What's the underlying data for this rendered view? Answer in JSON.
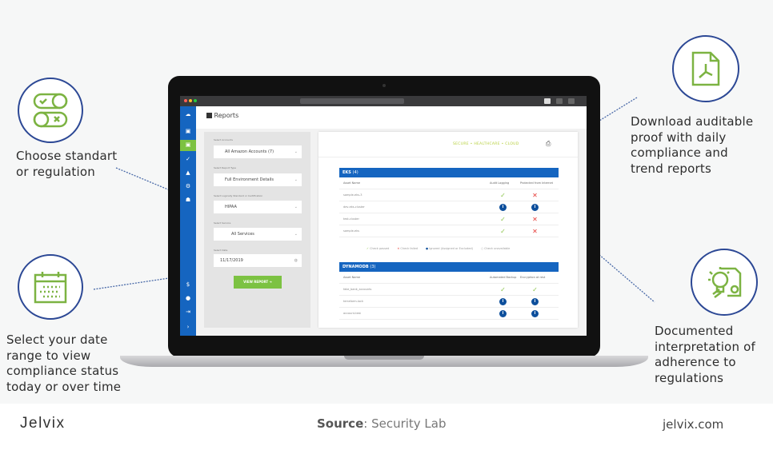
{
  "callouts": {
    "standard": [
      "Choose standart",
      "or regulation"
    ],
    "date": [
      "Select your date",
      "range to view",
      "compliance status",
      "today or over time"
    ],
    "download": [
      "Download auditable",
      "proof with daily",
      "compliance and",
      "trend reports"
    ],
    "documented": [
      "Documented",
      "interpretation of",
      "adherence to",
      "regulations"
    ]
  },
  "icons": {
    "standard": "toggle-switches-icon",
    "date": "calendar-icon",
    "download": "pdf-file-icon",
    "documented": "lightbulb-document-icon"
  },
  "colors": {
    "circle": "#2c4895",
    "icon": "#7cb342",
    "sidebar": "#1565c0",
    "button": "#7cc242",
    "tagline": "#b5cf3a"
  },
  "app": {
    "page_title": "Reports",
    "form": {
      "accounts_label": "Select Accounts",
      "accounts_value": "All Amazon Accounts (7)",
      "report_type_label": "Select Report Type",
      "report_type_value": "Full Environment Details",
      "standard_label": "Select Logically Standard or Certification",
      "standard_value": "HIPAA",
      "service_label": "Select Service",
      "service_value": "All Services",
      "date_label": "Select Date",
      "date_value": "11/17/2019",
      "view_button": "VIEW REPORT"
    },
    "tagline": "SECURE • HEALTHCARE • CLOUD",
    "eks": {
      "title": "EKS",
      "count": "(4)",
      "columns": [
        "Asset Name",
        "Audit Logging",
        "Protected from Internet"
      ],
      "rows": [
        {
          "name": "sample-eks-3",
          "c1": "pass",
          "c2": "fail"
        },
        {
          "name": "dev-eks-cluster",
          "c1": "info",
          "c2": "info"
        },
        {
          "name": "test-cluster",
          "c1": "pass",
          "c2": "fail"
        },
        {
          "name": "sample-eks",
          "c1": "pass",
          "c2": "fail"
        }
      ]
    },
    "legend": [
      "Check passed",
      "Check failed",
      "Ignored (Assigned or Excluded)",
      "Check unavailable"
    ],
    "dynamodb": {
      "title": "DYNAMODB",
      "count": "(3)",
      "columns": [
        "Asset Name",
        "Automated Backup",
        "Encryption at rest"
      ],
      "rows": [
        {
          "name": "fake_bank_accounts",
          "c1": "pass",
          "c2": "pass"
        },
        {
          "name": "terraform-lock",
          "c1": "info",
          "c2": "info"
        },
        {
          "name": "account-test",
          "c1": "info",
          "c2": "info"
        }
      ]
    }
  },
  "footer": {
    "logo": "Jelvix",
    "source_label": "Source",
    "source_value": ": Security Lab",
    "site": "jelvix.com"
  }
}
